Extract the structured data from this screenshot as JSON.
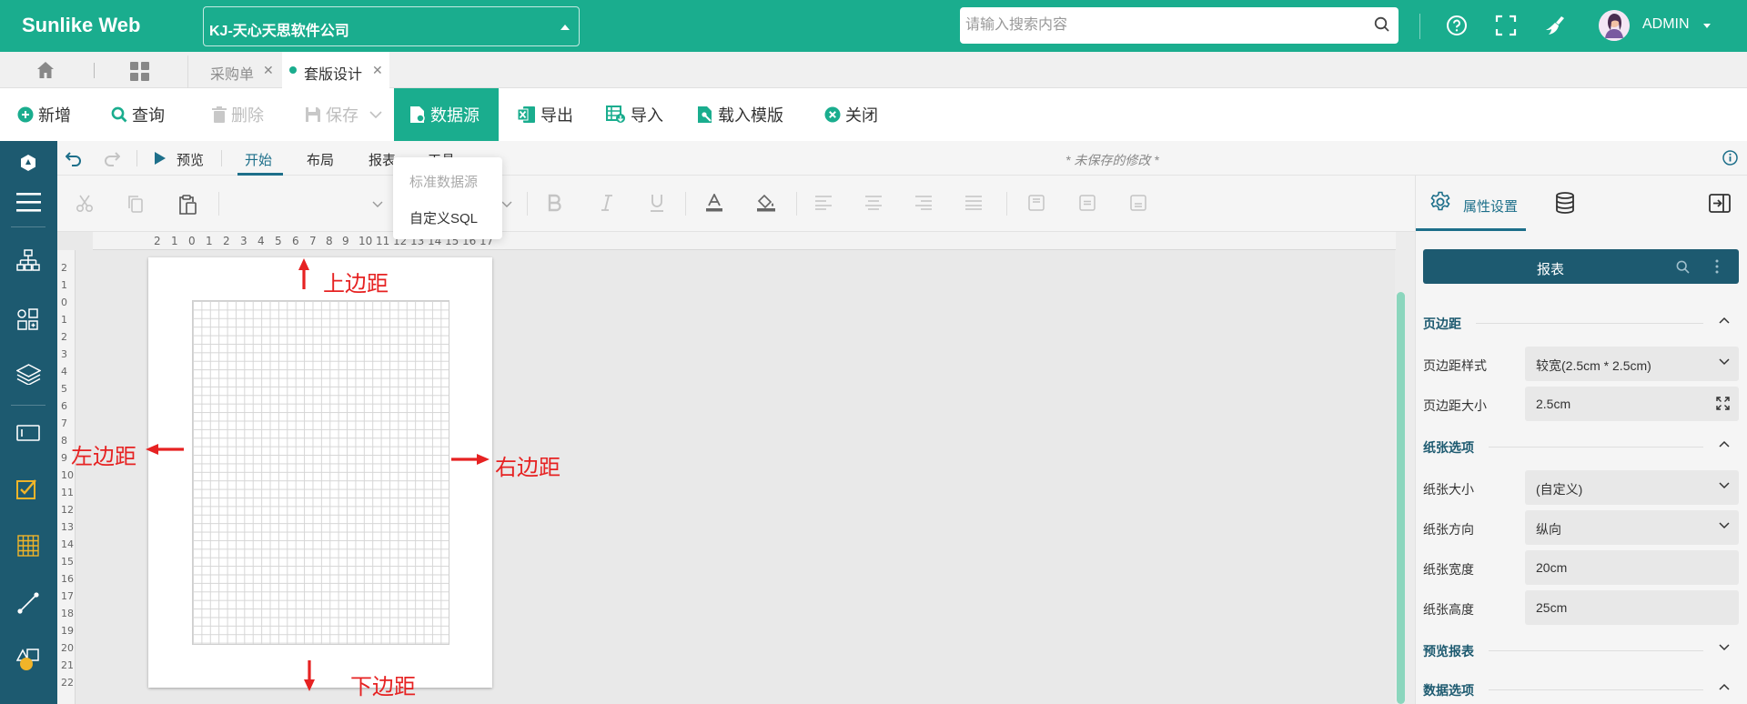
{
  "header": {
    "brand": "Sunlike Web",
    "company": "KJ-天心天思软件公司",
    "search_placeholder": "请输入搜索内容",
    "user": "ADMIN",
    "accent": "#1aad8e"
  },
  "tabs": [
    {
      "label": "采购单",
      "active": false
    },
    {
      "label": "套版设计",
      "active": true
    }
  ],
  "toolbar": {
    "new": "新增",
    "query": "查询",
    "delete": "删除",
    "save": "保存",
    "datasource": "数据源",
    "export": "导出",
    "import": "导入",
    "load_template": "载入模版",
    "close": "关闭"
  },
  "designer": {
    "preview": "预览",
    "tabs": [
      "开始",
      "布局",
      "报表"
    ],
    "hidden_tab_fragment": "工具",
    "unsaved": "* 未保存的修改 *"
  },
  "dropdown": {
    "items": [
      {
        "label": "标准数据源",
        "disabled": true
      },
      {
        "label": "自定义SQL",
        "disabled": false
      }
    ]
  },
  "ruler": {
    "horizontal": [
      "2",
      "1",
      "0",
      "1",
      "2",
      "3",
      "4",
      "5",
      "6",
      "7",
      "8",
      "9",
      "10",
      "11",
      "12",
      "13",
      "14",
      "15",
      "16",
      "17"
    ],
    "vertical": [
      "2",
      "1",
      "0",
      "1",
      "2",
      "3",
      "4",
      "5",
      "6",
      "7",
      "8",
      "9",
      "10",
      "11",
      "12",
      "13",
      "14",
      "15",
      "16",
      "17",
      "18",
      "19",
      "20",
      "21",
      "22"
    ]
  },
  "annotations": {
    "top": "上边距",
    "bottom": "下边距",
    "left": "左边距",
    "right": "右边距"
  },
  "panel": {
    "tab_label": "属性设置",
    "header_title": "报表",
    "sections": {
      "margin": "页边距",
      "paper": "纸张选项",
      "preview": "预览报表",
      "data": "数据选项"
    },
    "margin_style_label": "页边距样式",
    "margin_style_value": "较宽(2.5cm * 2.5cm)",
    "margin_size_label": "页边距大小",
    "margin_size_value": "2.5cm",
    "paper_size_label": "纸张大小",
    "paper_size_value": "(自定义)",
    "orientation_label": "纸张方向",
    "orientation_value": "纵向",
    "width_label": "纸张宽度",
    "width_value": "20cm",
    "height_label": "纸张高度",
    "height_value": "25cm"
  }
}
